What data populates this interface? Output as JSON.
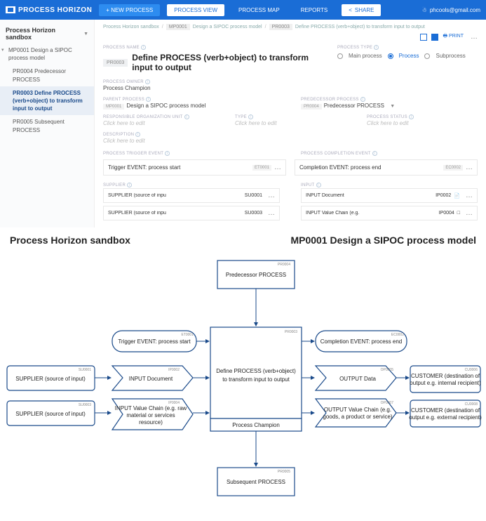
{
  "header": {
    "brand": "PROCESS HORIZON",
    "new_process": "+  NEW PROCESS",
    "process_view": "PROCESS VIEW",
    "process_map": "PROCESS MAP",
    "reports": "REPORTS",
    "share": "SHARE",
    "user": "phcools@gmail.com"
  },
  "sidebar": {
    "title": "Process Horizon sandbox",
    "items": [
      {
        "id": "MP0001",
        "label": "Design a SIPOC process model"
      },
      {
        "id": "PR0004",
        "label": "Predecessor PROCESS"
      },
      {
        "id": "PR0003",
        "label": "Define PROCESS (verb+object) to transform input to output"
      },
      {
        "id": "PR0005",
        "label": "Subsequent PROCESS"
      }
    ]
  },
  "breadcrumb": {
    "root": "Process Horizon sandbox",
    "mp_id": "MP0001",
    "mp_label": "Design a SIPOC process model",
    "pr_id": "PR0003",
    "pr_label": "Define PROCESS (verb+object) to transform input to output",
    "print": "PRINT"
  },
  "form": {
    "name_label": "PROCESS NAME",
    "code": "PR0003",
    "title": "Define PROCESS (verb+object) to transform input to output",
    "owner_label": "PROCESS OWNER",
    "owner": "Process Champion",
    "type_label": "PROCESS TYPE",
    "type_main": "Main process",
    "type_process": "Process",
    "type_sub": "Subprocess",
    "parent_label": "PARENT PROCESS",
    "parent_code": "MP0001",
    "parent_name": "Design a SIPOC process model",
    "pred_label": "PREDECESSOR PROCESS",
    "pred_code": "PR0004",
    "pred_name": "Predecessor PROCESS",
    "resp_label": "RESPONSIBLE ORGANIZATION UNIT",
    "typefield_label": "TYPE",
    "status_label": "PROCESS STATUS",
    "desc_label": "DESCRIPTION",
    "edit_placeholder": "Click here to edit",
    "trigger_section": "PROCESS TRIGGER EVENT",
    "completion_section": "PROCESS COMPLETION EVENT",
    "trigger_text": "Trigger EVENT: process start",
    "trigger_code": "ET0001",
    "completion_text": "Completion EVENT: process end",
    "completion_code": "EC0002",
    "supplier_section": "SUPPLIER",
    "input_section": "INPUT",
    "suppliers": [
      {
        "txt": "SUPPLIER (source of inpu",
        "code": "SU0001"
      },
      {
        "txt": "SUPPLIER (source of inpu",
        "code": "SU0003"
      }
    ],
    "inputs": [
      {
        "txt": "INPUT Document",
        "code": "IP0002"
      },
      {
        "txt": "INPUT Value Chain (e.g.",
        "code": "IP0004"
      }
    ]
  },
  "diagram": {
    "left_title": "Process Horizon sandbox",
    "right_title": "MP0001 Design a SIPOC process model",
    "nodes": {
      "pred": {
        "id": "PR0004",
        "label": "Predecessor PROCESS"
      },
      "trig": {
        "id": "ET0001",
        "label": "Trigger EVENT: process start"
      },
      "sup1": {
        "id": "SU0001",
        "label": "SUPPLIER (source of input)"
      },
      "sup2": {
        "id": "SU0003",
        "label": "SUPPLIER (source of input)"
      },
      "inp1": {
        "id": "IP0002",
        "label": "INPUT Document"
      },
      "inp2": {
        "id": "IP0004",
        "label1": "INPUT Value Chain (e.g. raw",
        "label2": "material or services",
        "label3": "resource)"
      },
      "main": {
        "id": "PR0003",
        "label1": "Define PROCESS (verb+object)",
        "label2": "to transform input to output",
        "owner": "Process Champion"
      },
      "comp": {
        "id": "EC0002",
        "label": "Completion EVENT: process end"
      },
      "out1": {
        "id": "OP0005",
        "label": "OUTPUT Data"
      },
      "out2": {
        "id": "OP0007",
        "label1": "OUTPUT Value Chain (e.g.",
        "label2": "goods, a product or service)"
      },
      "cus1": {
        "id": "CU0006",
        "label1": "CUSTOMER (destination of",
        "label2": "output e.g. internal recipient)"
      },
      "cus2": {
        "id": "CU0008",
        "label1": "CUSTOMER (destination of",
        "label2": "output e.g. external recipient)"
      },
      "subs": {
        "id": "PR0005",
        "label": "Subsequent PROCESS"
      }
    }
  }
}
